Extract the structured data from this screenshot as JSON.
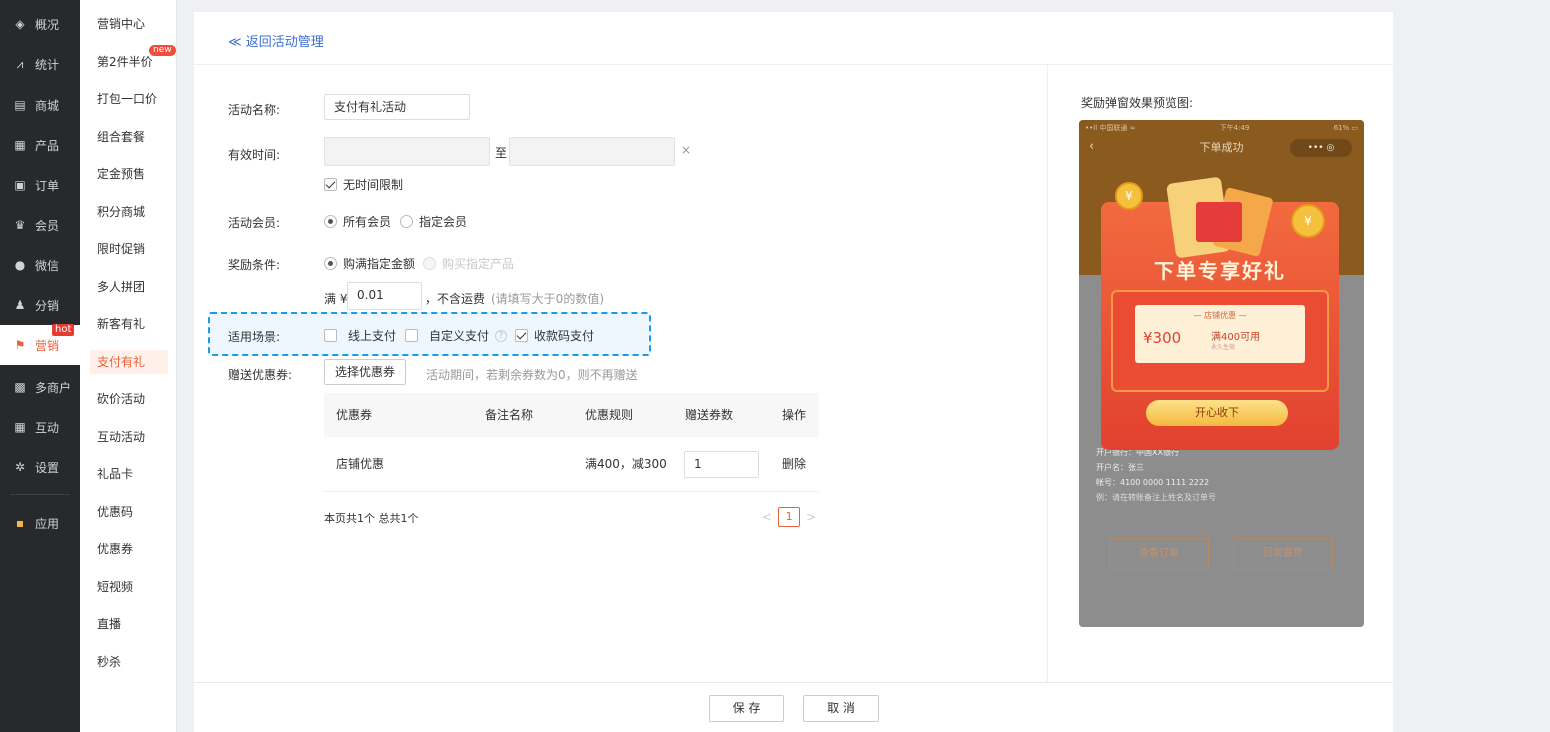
{
  "nav_primary": [
    {
      "label": "概况",
      "icon": "layers-icon",
      "glyph": "◈"
    },
    {
      "label": "统计",
      "icon": "stats-icon",
      "glyph": "⩘"
    },
    {
      "label": "商城",
      "icon": "shop-icon",
      "glyph": "▤"
    },
    {
      "label": "产品",
      "icon": "grid-icon",
      "glyph": "▦"
    },
    {
      "label": "订单",
      "icon": "order-icon",
      "glyph": "▣"
    },
    {
      "label": "会员",
      "icon": "crown-icon",
      "glyph": "♛"
    },
    {
      "label": "微信",
      "icon": "wechat-icon",
      "glyph": "●"
    },
    {
      "label": "分销",
      "icon": "distribution-icon",
      "glyph": "♟"
    },
    {
      "label": "营销",
      "icon": "flag-icon",
      "glyph": "⚑"
    },
    {
      "label": "多商户",
      "icon": "merchant-icon",
      "glyph": "▩"
    },
    {
      "label": "互动",
      "icon": "interact-icon",
      "glyph": "▦"
    },
    {
      "label": "设置",
      "icon": "gear-icon",
      "glyph": "✲"
    },
    {
      "label": "应用",
      "icon": "apps-icon",
      "glyph": "▪"
    }
  ],
  "nav_primary_active": "营销",
  "hot_badge": "hot",
  "nav_secondary": [
    "营销中心",
    "第2件半价",
    "打包一口价",
    "组合套餐",
    "定金预售",
    "积分商城",
    "限时促销",
    "多人拼团",
    "新客有礼",
    "支付有礼",
    "砍价活动",
    "互动活动",
    "礼品卡",
    "优惠码",
    "优惠券",
    "短视频",
    "直播",
    "秒杀"
  ],
  "nav_secondary_active": "支付有礼",
  "new_badge": "new",
  "back_link": "≪ 返回活动管理",
  "form": {
    "name_label": "活动名称:",
    "name_value": "支付有礼活动",
    "time_label": "有效时间:",
    "time_to": "至",
    "time_clear": "×",
    "no_limit": "无时间限制",
    "member_label": "活动会员:",
    "member_all": "所有会员",
    "member_specified": "指定会员",
    "reward_label": "奖励条件:",
    "reward_amount": "购满指定金额",
    "reward_product": "购买指定产品",
    "full_prefix": "满 ¥",
    "full_value": "0.01",
    "full_suffix": "，不含运费",
    "full_hint": "(请填写大于0的数值)",
    "scene_label": "适用场景:",
    "scene_online": "线上支付",
    "scene_custom": "自定义支付",
    "scene_help": "?",
    "scene_qr": "收款码支付",
    "coupon_label": "赠送优惠券:",
    "coupon_btn": "选择优惠券",
    "coupon_hint": "活动期间，若剩余券数为0，则不再赠送"
  },
  "table": {
    "headers": [
      "优惠券",
      "备注名称",
      "优惠规则",
      "赠送券数",
      "操作"
    ],
    "rows": [
      {
        "coupon": "店铺优惠",
        "remark": "",
        "rule": "满400，减300",
        "count": "1",
        "action": "删除"
      }
    ],
    "summary": "本页共1个 总共1个",
    "page": "1",
    "prev": "<",
    "next": ">"
  },
  "preview": {
    "title": "奖励弹窗效果预览图:",
    "status_left": "••ll 中国联通 ≈",
    "status_time": "下午4:49",
    "status_right": "61% ▭",
    "page_title": "下单成功",
    "dots": "••• ◎",
    "popup_heading": "下单专享好礼",
    "ticket_title": "— 店铺优惠 —",
    "ticket_amount": "¥300",
    "ticket_condition": "满400可用",
    "ticket_validity": "永久生效",
    "cta": "开心收下",
    "bank_lines": [
      "开户银行：中国XX银行",
      "开户名：张三",
      "帐号：4100 0000 1111 2222",
      "例：请在转账备注上姓名及订单号"
    ],
    "btn_order": "查看订单",
    "btn_home": "回到首页"
  },
  "footer": {
    "save": "保 存",
    "cancel": "取 消"
  }
}
